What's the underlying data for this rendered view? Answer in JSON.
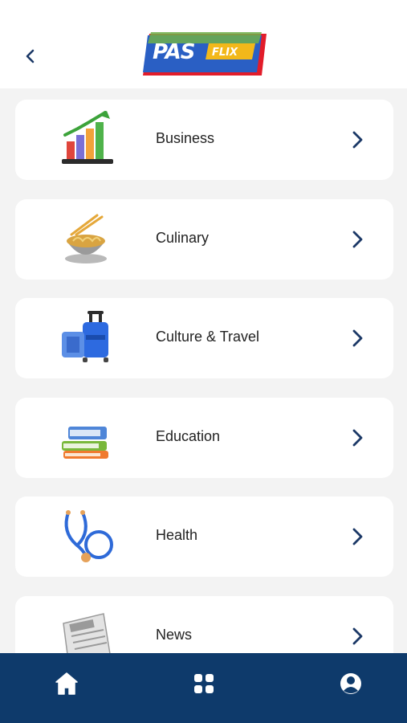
{
  "header": {
    "back_icon": "chevron-left-icon",
    "logo": {
      "text_primary": "PAS",
      "text_secondary": "FLIX"
    }
  },
  "categories": [
    {
      "label": "Business",
      "icon": "growth-chart-icon"
    },
    {
      "label": "Culinary",
      "icon": "noodle-bowl-icon"
    },
    {
      "label": "Culture & Travel",
      "icon": "luggage-icon"
    },
    {
      "label": "Education",
      "icon": "books-icon"
    },
    {
      "label": "Health",
      "icon": "stethoscope-icon"
    },
    {
      "label": "News",
      "icon": "newspaper-icon"
    }
  ],
  "bottom_nav": {
    "items": [
      {
        "icon": "home-icon"
      },
      {
        "icon": "grid-icon"
      },
      {
        "icon": "profile-icon"
      }
    ]
  },
  "colors": {
    "nav_background": "#0e3a6b",
    "chevron": "#1b3866",
    "page_background": "#f3f3f3"
  }
}
